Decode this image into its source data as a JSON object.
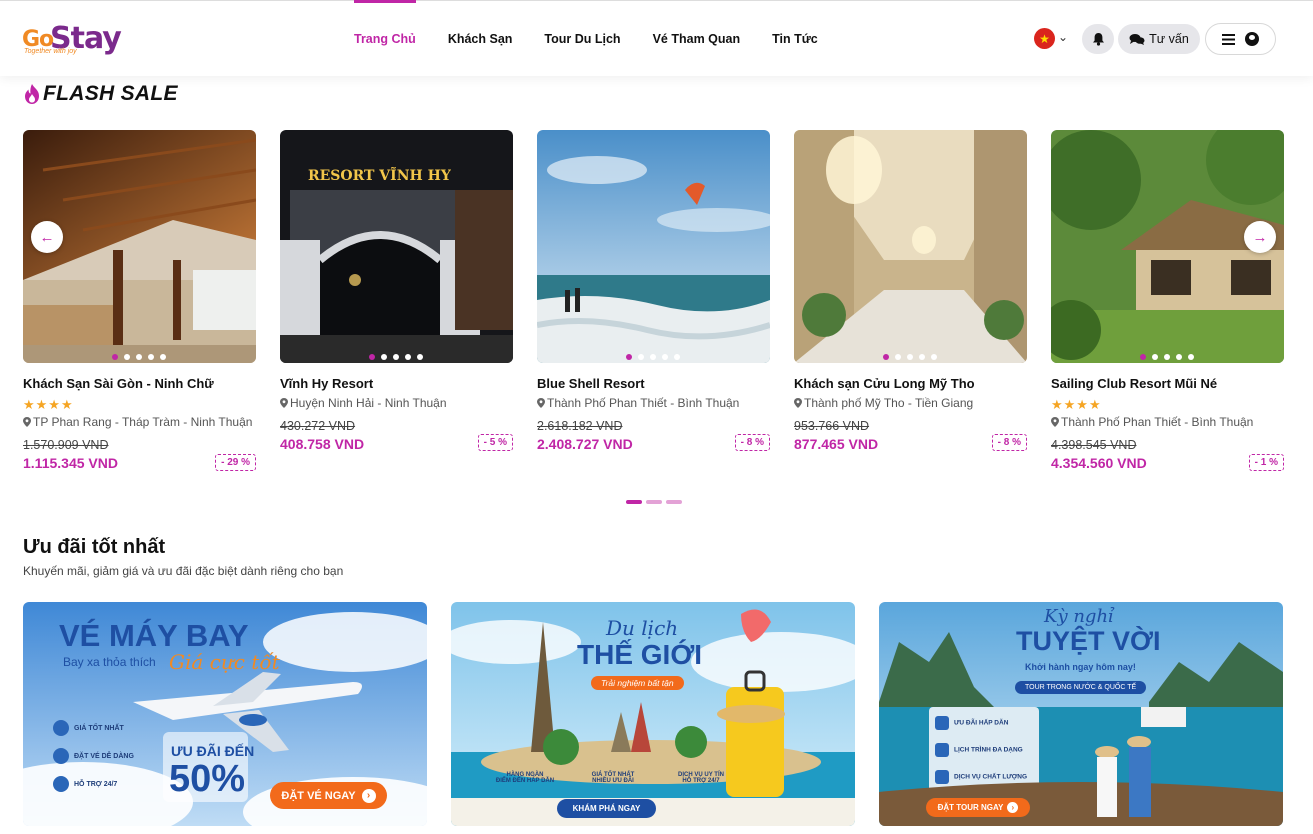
{
  "header": {
    "logo_go": "Go",
    "logo_stay": "Stay",
    "logo_tagline": "Together with joy",
    "nav": [
      "Trang Chủ",
      "Khách Sạn",
      "Tour Du Lịch",
      "Vé Tham Quan",
      "Tin Tức"
    ],
    "nav_active": "Trang Chủ",
    "advice_label": "Tư vấn",
    "language_flag": "vietnam-flag-icon"
  },
  "flash_sale": {
    "title": "FLASH SALE",
    "cards": [
      {
        "name": "Khách Sạn Sài Gòn - Ninh Chữ",
        "stars": "★★★★",
        "location": "TP Phan Rang - Tháp Tràm - Ninh Thuận",
        "old_price": "1.570.909 VND",
        "new_price": "1.115.345 VND",
        "discount": "- 29 %"
      },
      {
        "name": "Vĩnh Hy Resort",
        "stars": "",
        "location": "Huyện Ninh Hải - Ninh Thuận",
        "old_price": "430.272 VND",
        "new_price": "408.758 VND",
        "discount": "- 5 %",
        "sign": "RESORT VĨNH HY"
      },
      {
        "name": "Blue Shell Resort",
        "stars": "",
        "location": "Thành Phố Phan Thiết - Bình Thuận",
        "old_price": "2.618.182 VND",
        "new_price": "2.408.727 VND",
        "discount": "- 8 %"
      },
      {
        "name": "Khách sạn Cửu Long Mỹ Tho",
        "stars": "",
        "location": "Thành phố Mỹ Tho - Tiền Giang",
        "old_price": "953.766 VND",
        "new_price": "877.465 VND",
        "discount": "- 8 %"
      },
      {
        "name": "Sailing Club Resort Mũi Né",
        "stars": "★★★★",
        "location": "Thành Phố Phan Thiết - Bình Thuận",
        "old_price": "4.398.545 VND",
        "new_price": "4.354.560 VND",
        "discount": "- 1 %"
      }
    ],
    "prev_arrow": "←",
    "next_arrow": "→"
  },
  "best_deals": {
    "title": "Ưu đãi tốt nhất",
    "subtitle": "Khuyến mãi, giảm giá và ưu đãi đặc biệt dành riêng cho bạn",
    "banners": [
      {
        "headline": "VÉ MÁY BAY",
        "sub": "Bay xa thỏa thích",
        "script": "Giá cực tốt",
        "features": [
          "GIÁ TỐT NHẤT",
          "ĐẶT VÉ DỄ DÀNG",
          "HỖ TRỢ 24/7"
        ],
        "promo_label": "ƯU ĐÃI ĐẾN",
        "promo_value": "50%",
        "cta": "ĐẶT VÉ NGAY"
      },
      {
        "script": "Du lịch",
        "headline": "THẾ GIỚI",
        "ribbon": "Trải nghiệm bất tận",
        "features": [
          "HÀNG NGÀN\nĐIỂM ĐẾN HẤP DẪN",
          "GIÁ TỐT NHẤT\nNHIỀU ƯU ĐÃI",
          "DỊCH VỤ UY TÍN\nHỖ TRỢ 24/7"
        ],
        "cta": "KHÁM PHÁ NGAY"
      },
      {
        "script": "Kỳ nghỉ",
        "headline": "TUYỆT VỜI",
        "sub": "Khởi hành ngay hôm nay!",
        "ribbon": "TOUR TRONG NƯỚC & QUỐC TẾ",
        "features": [
          "ƯU ĐÃI HẤP DẪN",
          "LỊCH TRÌNH ĐA DẠNG",
          "DỊCH VỤ CHẤT LƯỢNG"
        ],
        "cta": "ĐẶT TOUR NGAY"
      }
    ]
  }
}
